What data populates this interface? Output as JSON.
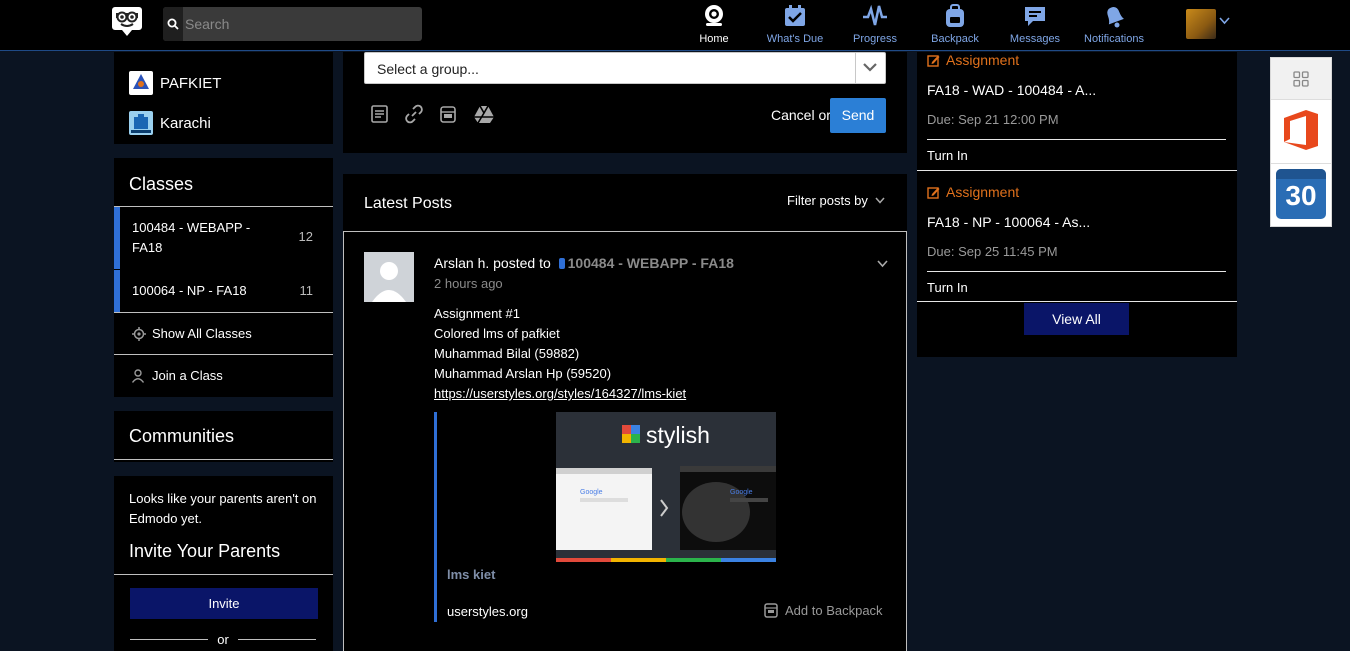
{
  "search": {
    "placeholder": "Search"
  },
  "nav": [
    {
      "label": "Home",
      "icon": "home-icon"
    },
    {
      "label": "What's Due",
      "icon": "calendar-check-icon"
    },
    {
      "label": "Progress",
      "icon": "pulse-icon"
    },
    {
      "label": "Backpack",
      "icon": "backpack-icon"
    },
    {
      "label": "Messages",
      "icon": "chat-icon"
    },
    {
      "label": "Notifications",
      "icon": "bell-icon"
    }
  ],
  "groups": [
    {
      "name": "PAFKIET"
    },
    {
      "name": "Karachi"
    }
  ],
  "classes": {
    "title": "Classes",
    "items": [
      {
        "name": "100484 - WEBAPP - FA18",
        "count": "12"
      },
      {
        "name": "100064 - NP - FA18",
        "count": "11"
      }
    ],
    "show_all": "Show All Classes",
    "join": "Join a Class"
  },
  "communities": {
    "title": "Communities"
  },
  "parents": {
    "message": "Looks like your parents aren't on Edmodo yet.",
    "title": "Invite Your Parents",
    "invite_label": "Invite",
    "or_label": "or"
  },
  "composer": {
    "group_placeholder": "Select a group...",
    "cancel_or": "Cancel or",
    "send_label": "Send"
  },
  "feed": {
    "title": "Latest Posts",
    "filter_label": "Filter posts by"
  },
  "post": {
    "author": "Arslan h.",
    "posted_to": "posted to",
    "group": "100484 - WEBAPP - FA18",
    "time": "2 hours ago",
    "lines": [
      "Assignment #1",
      "Colored lms of pafkiet",
      "Muhammad Bilal (59882)",
      "Muhammad Arslan Hp (59520)"
    ],
    "link": "https://userstyles.org/styles/164327/lms-kiet",
    "attachment": {
      "brand": "stylish",
      "google_text": "Google",
      "title": "lms kiet",
      "source": "userstyles.org",
      "backpack_label": "Add to Backpack"
    }
  },
  "assignments": [
    {
      "tag": "Assignment",
      "title": "FA18 - WAD - 100484 - A...",
      "due": "Due: Sep 21 12:00 PM",
      "turn_in": "Turn In"
    },
    {
      "tag": "Assignment",
      "title": "FA18 - NP - 100064 - As...",
      "due": "Due: Sep 25 11:45 PM",
      "turn_in": "Turn In"
    }
  ],
  "view_all_label": "View All",
  "dock": {
    "calendar_day": "30"
  },
  "colors": {
    "accent": "#2f6fd6",
    "assignment": "#e0711c",
    "button_dark": "#0a1568",
    "send": "#2b7fd6"
  }
}
